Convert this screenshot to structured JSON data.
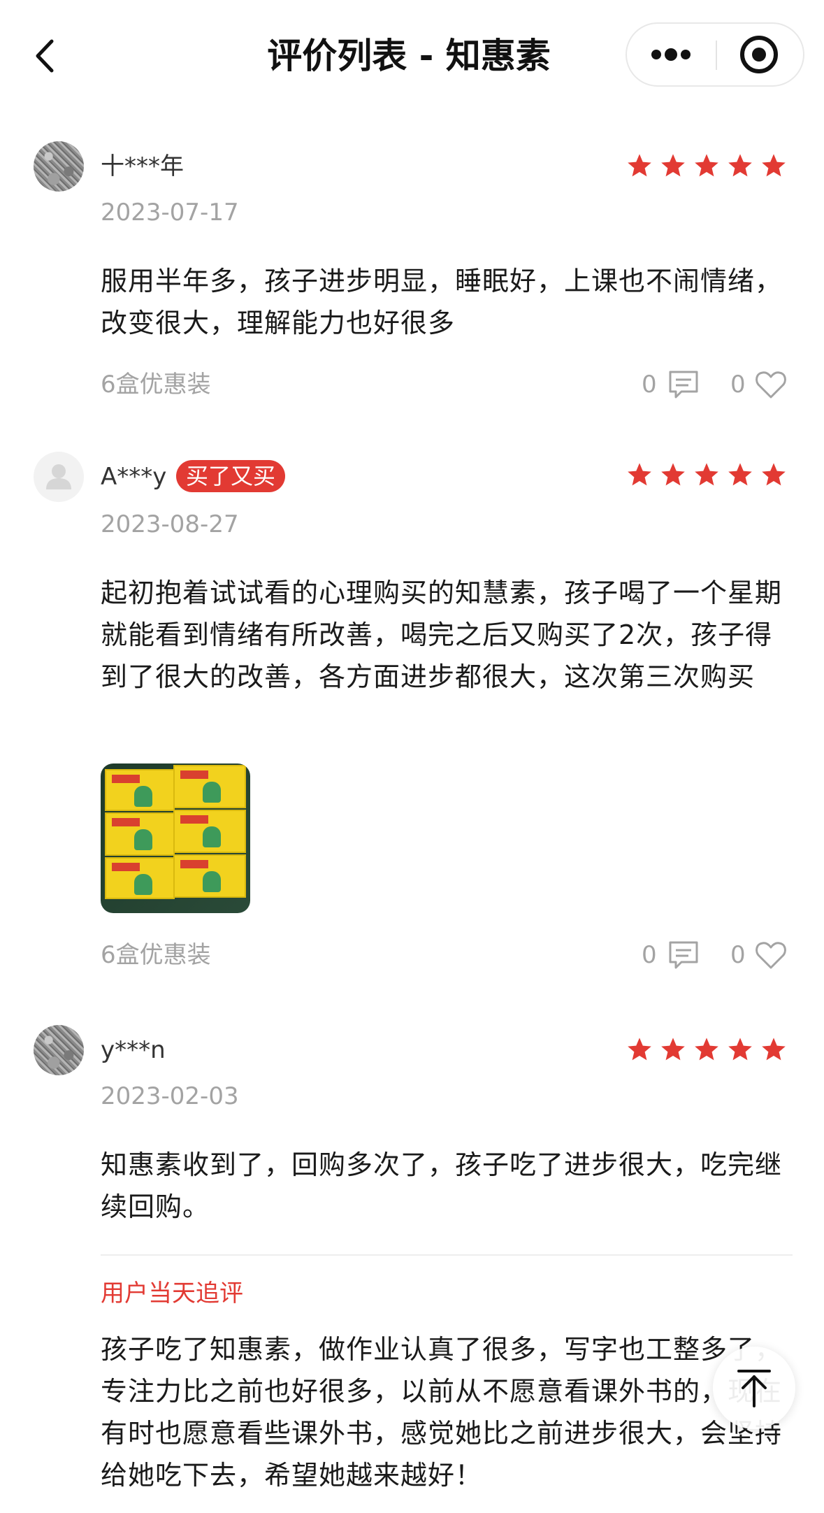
{
  "header": {
    "title": "评价列表 - 知惠素",
    "icons": {
      "back": "chevron-left-icon",
      "more": "more-dots-icon",
      "target": "target-circle-icon"
    }
  },
  "colors": {
    "accent": "#e23a33",
    "muted": "#a3a3a3",
    "text": "#1a1a1a"
  },
  "reviews": [
    {
      "username": "十***年",
      "avatar": "noise-avatar",
      "rating": 5,
      "date": "2023-07-17",
      "content": "服用半年多，孩子进步明显，睡眠好，上课也不闹情绪，改变很大，理解能力也好很多",
      "spec": "6盒优惠装",
      "comment_count": "0",
      "like_count": "0"
    },
    {
      "username": "A***y",
      "avatar": "default-avatar",
      "badge": "买了又买",
      "rating": 5,
      "date": "2023-08-27",
      "content": "起初抱着试试看的心理购买的知慧素，孩子喝了一个星期就能看到情绪有所改善，喝完之后又购买了2次，孩子得到了很大的改善，各方面进步都很大，这次第三次购买",
      "has_photo": true,
      "spec": "6盒优惠装",
      "comment_count": "0",
      "like_count": "0"
    },
    {
      "username": "y***n",
      "avatar": "noise-avatar",
      "rating": 5,
      "date": "2023-02-03",
      "content": "知惠素收到了，回购多次了，孩子吃了进步很大，吃完继续回购。",
      "followup_label": "用户当天追评",
      "followup_content": "孩子吃了知惠素，做作业认真了很多，写字也工整多了，专注力比之前也好很多，以前从不愿意看课外书的，现在有时也愿意看些课外书，感觉她比之前进步很大，会坚持给她吃下去，希望她越来越好！"
    }
  ],
  "scroll_top": {
    "icon": "arrow-up-icon"
  }
}
